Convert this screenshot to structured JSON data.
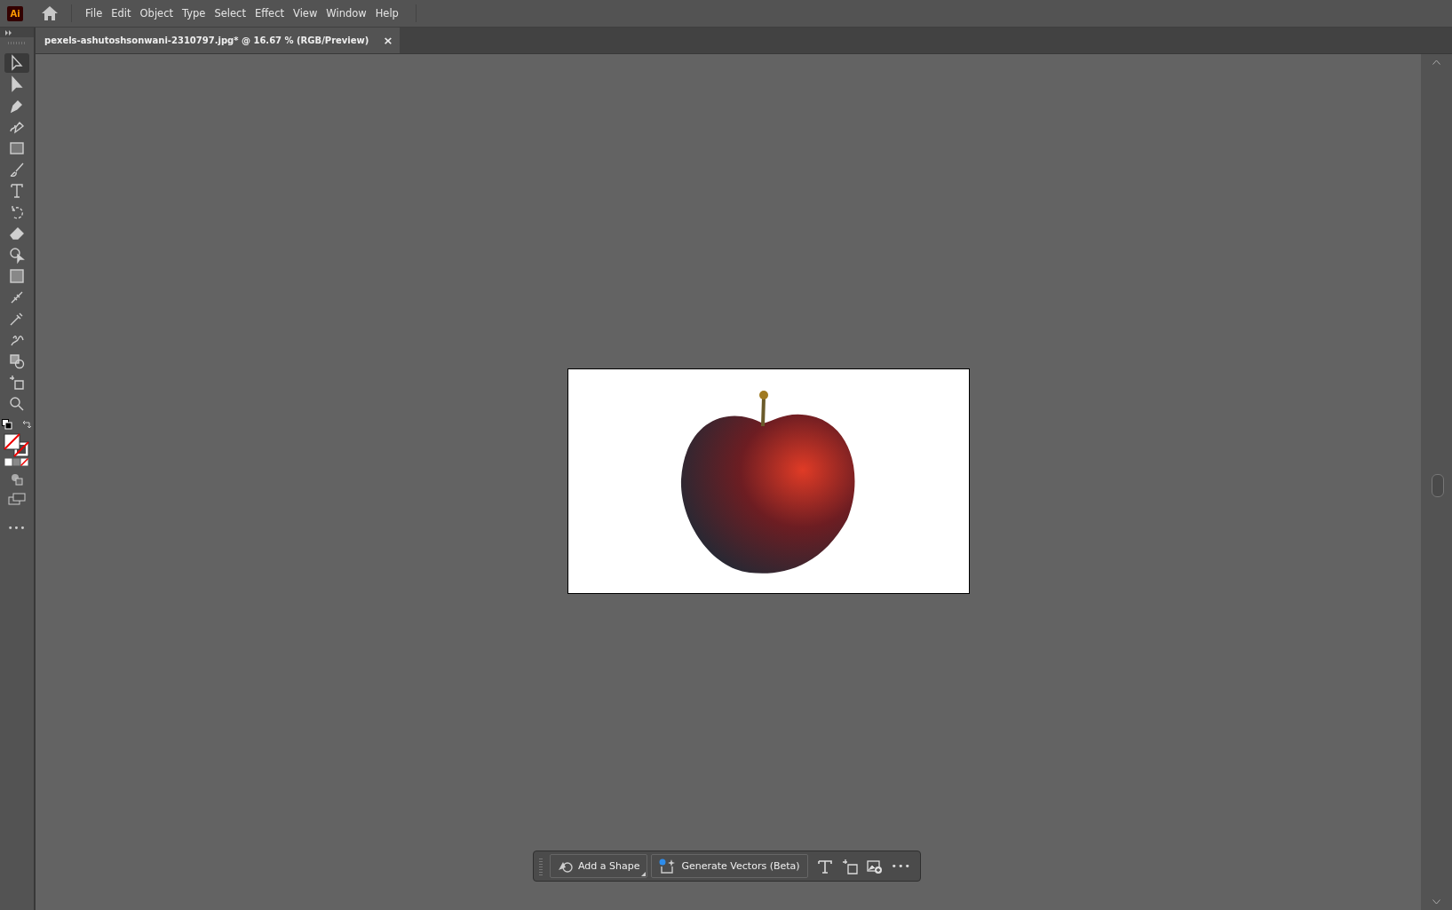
{
  "app_logo": "Ai",
  "menu": [
    "File",
    "Edit",
    "Object",
    "Type",
    "Select",
    "Effect",
    "View",
    "Window",
    "Help"
  ],
  "document_tab": {
    "title": "pexels-ashutoshsonwani-2310797.jpg* @ 16.67 % (RGB/Preview)",
    "close": "×",
    "selected": true
  },
  "tools": [
    {
      "selected": true
    },
    {
      "selected": false
    },
    {
      "selected": false
    },
    {
      "selected": false
    },
    {
      "selected": false
    },
    {
      "selected": false
    },
    {
      "selected": false
    },
    {
      "selected": false
    },
    {
      "selected": false
    },
    {
      "selected": false
    },
    {
      "selected": false
    },
    {
      "selected": false
    },
    {
      "selected": false
    },
    {
      "selected": false
    },
    {
      "selected": false
    },
    {
      "selected": false
    },
    {
      "selected": false
    }
  ],
  "more_tools": "•••",
  "contextual_bar": {
    "buttons": [
      {
        "label": "Add a Shape"
      },
      {
        "label": "Generate Vectors (Beta)"
      }
    ],
    "more": "•••"
  }
}
